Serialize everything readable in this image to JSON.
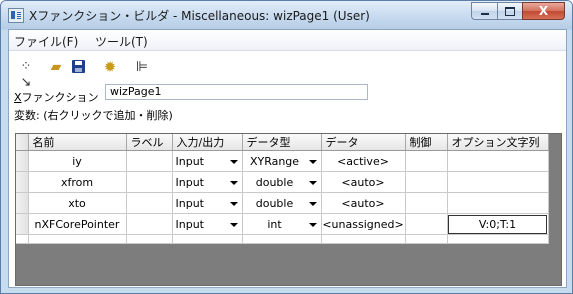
{
  "window": {
    "title": "Xファンクション・ビルダ - Miscellaneous: wizPage1 (User)",
    "controls": {
      "minimize": "minimize",
      "maximize": "maximize",
      "close": "X"
    }
  },
  "menu": [
    {
      "label": "ファイル(F)"
    },
    {
      "label": "ツール(T)"
    }
  ],
  "toolbar": {
    "icons": [
      "new-wand-icon",
      "open-folder-icon",
      "save-disk-icon",
      "gear-icon",
      "tree-view-icon"
    ]
  },
  "xfunction": {
    "label_underlined": "X",
    "label_rest": "ファンクション",
    "value": "wizPage1"
  },
  "variables_label": "変数: (右クリックで追加・削除)",
  "grid": {
    "columns": [
      "名前",
      "ラベル",
      "入力/出力",
      "データ型",
      "データ",
      "制御",
      "オプション文字列"
    ],
    "rows": [
      {
        "name": "iy",
        "label": "",
        "io": "Input",
        "type": "XYRange",
        "data": "<active>",
        "control": "",
        "option": ""
      },
      {
        "name": "xfrom",
        "label": "",
        "io": "Input",
        "type": "double",
        "data": "<auto>",
        "control": "",
        "option": ""
      },
      {
        "name": "xto",
        "label": "",
        "io": "Input",
        "type": "double",
        "data": "<auto>",
        "control": "",
        "option": ""
      },
      {
        "name": "nXFCorePointer",
        "label": "",
        "io": "Input",
        "type": "int",
        "data": "<unassigned>",
        "control": "",
        "option": "V:0;T:1"
      }
    ]
  },
  "colors": {
    "titlebar": "#c5d9ee",
    "close_button": "#c14a33",
    "grid_background": "#7d7d7d"
  }
}
